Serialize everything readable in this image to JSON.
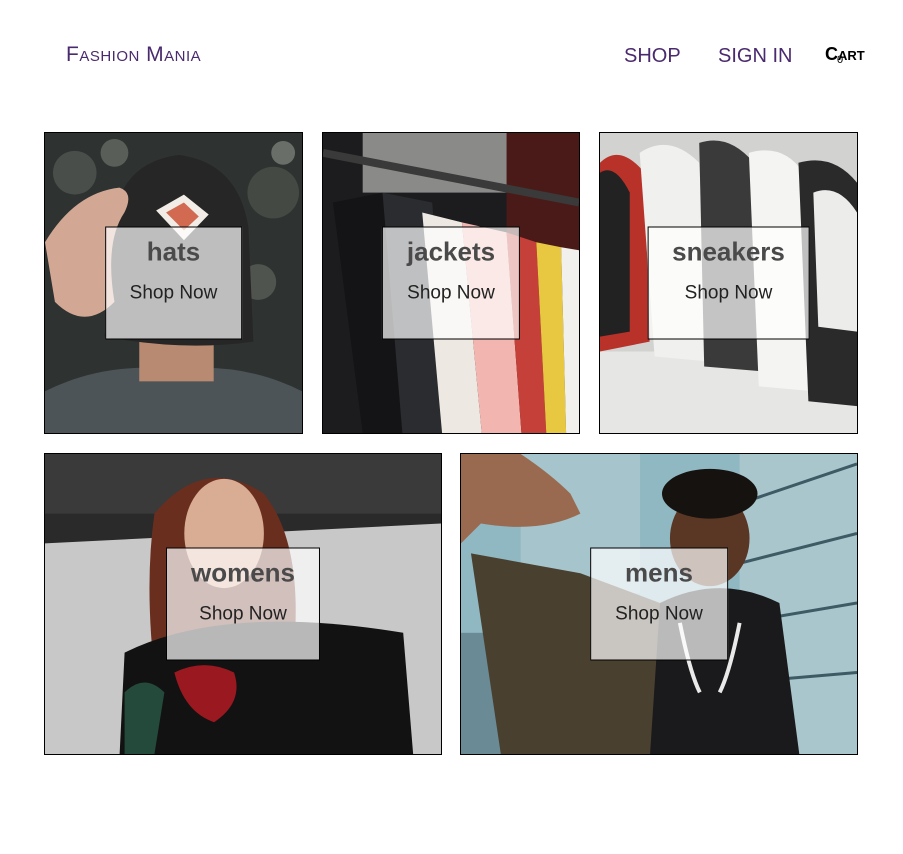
{
  "header": {
    "logo": "Fashion Mania",
    "nav": {
      "shop": "SHOP",
      "sign_in": "SIGN IN"
    },
    "cart": {
      "label": "Cart",
      "count": "0"
    },
    "link_color": "#4a2a6e"
  },
  "categories": [
    {
      "title": "hats",
      "cta": "Shop Now"
    },
    {
      "title": "jackets",
      "cta": "Shop Now"
    },
    {
      "title": "sneakers",
      "cta": "Shop Now"
    },
    {
      "title": "womens",
      "cta": "Shop Now"
    },
    {
      "title": "mens",
      "cta": "Shop Now"
    }
  ]
}
